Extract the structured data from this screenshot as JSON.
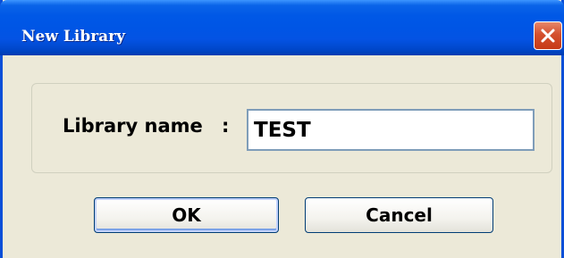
{
  "window": {
    "title": "New Library"
  },
  "form": {
    "label": "Library name",
    "separator": ":",
    "name_value": "TEST"
  },
  "buttons": {
    "ok_label": "OK",
    "cancel_label": "Cancel"
  },
  "icons": {
    "close": "close-icon"
  },
  "colors": {
    "titlebar": "#0055e5",
    "dialog_background": "#ece9d8",
    "close_button": "#d4502e",
    "input_border": "#7f9db9"
  }
}
